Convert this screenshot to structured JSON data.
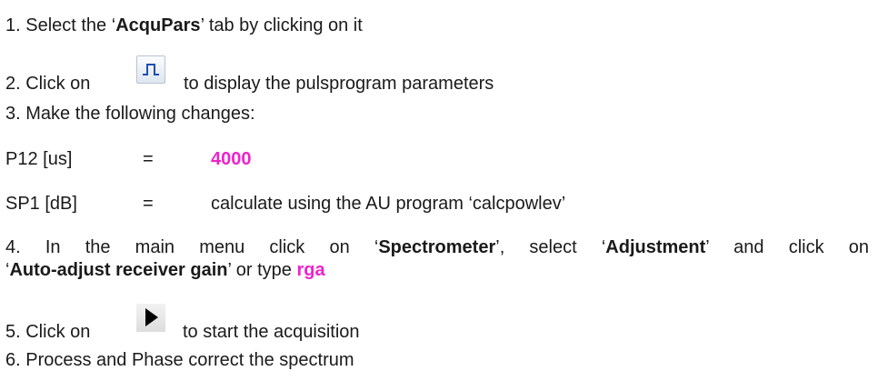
{
  "step1": {
    "prefix": "1. Select the ‘",
    "bold": "AcquPars",
    "suffix": "’ tab by clicking on it"
  },
  "step2": {
    "prefix": "2. Click on",
    "suffix": "to display the pulsprogram parameters",
    "icon": "pulse-program-icon"
  },
  "step3": {
    "text": "3. Make the following changes:"
  },
  "params": [
    {
      "name": "P12 [us]",
      "eq": "=",
      "value": "4000",
      "value_highlight": true
    },
    {
      "name": "SP1 [dB]",
      "eq": "=",
      "value": "calculate using the AU program ‘calcpowlev’",
      "value_highlight": false
    }
  ],
  "step4": {
    "p1": "4. In the main menu click on ‘",
    "b1": "Spectrometer",
    "p2": "’, select ‘",
    "b2": "Adjustment",
    "p3": "’ and click on",
    "p4": "‘",
    "b3": "Auto-adjust receiver gain",
    "p5": "’ or type ",
    "cmd": "rga"
  },
  "step5": {
    "prefix": "5. Click on",
    "suffix": "to start the acquisition",
    "icon": "play-icon"
  },
  "step6": {
    "text": "6. Process and Phase correct the spectrum"
  },
  "colors": {
    "highlight": "#ee22cc",
    "text": "#1a1a1a",
    "icon_border": "#b7c3d2"
  }
}
